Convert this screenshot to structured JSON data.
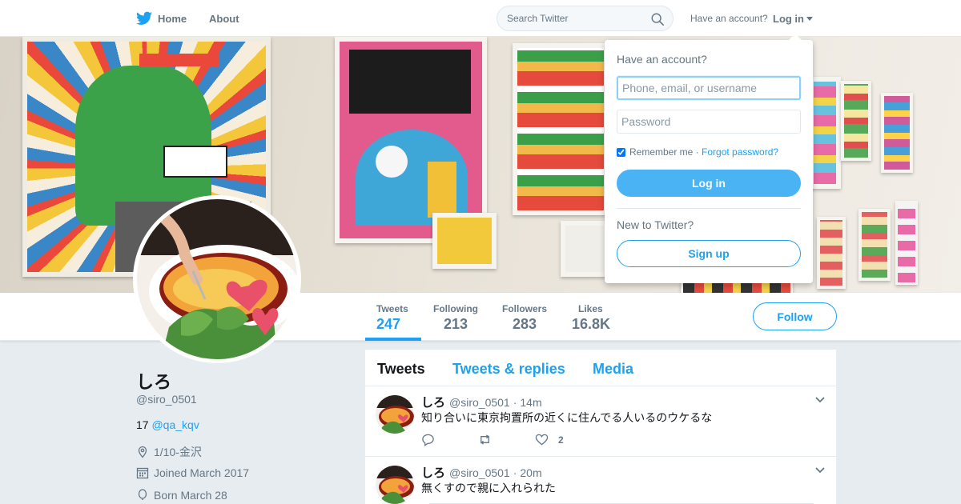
{
  "nav": {
    "home": "Home",
    "about": "About",
    "search_placeholder": "Search Twitter",
    "have_account": "Have an account?",
    "login": "Log in"
  },
  "profile": {
    "name": "しろ",
    "handle": "@siro_0501",
    "bio_prefix": "17",
    "bio_mention": "@qa_kqv",
    "location": "1/10-金沢",
    "joined": "Joined March 2017",
    "born": "Born March 28"
  },
  "stats": [
    {
      "label": "Tweets",
      "value": "247"
    },
    {
      "label": "Following",
      "value": "213"
    },
    {
      "label": "Followers",
      "value": "283"
    },
    {
      "label": "Likes",
      "value": "16.8K"
    }
  ],
  "follow_label": "Follow",
  "tabs": [
    "Tweets",
    "Tweets & replies",
    "Media"
  ],
  "tweets": [
    {
      "name": "しろ",
      "handle": "@siro_0501",
      "time": "14m",
      "text": "知り合いに東京拘置所の近くに住んでる人いるのウケるな",
      "likes": "2"
    },
    {
      "name": "しろ",
      "handle": "@siro_0501",
      "time": "20m",
      "text": "無くすので親に入れられた",
      "likes": ""
    }
  ],
  "login_dropdown": {
    "question": "Have an account?",
    "username_placeholder": "Phone, email, or username",
    "password_placeholder": "Password",
    "remember": "Remember me",
    "forgot": "Forgot password?",
    "login_button": "Log in",
    "new_question": "New to Twitter?",
    "signup_button": "Sign up"
  },
  "colors": {
    "accent": "#1da1f2",
    "login_button": "#4ab3f4",
    "page_bg": "#e6ecf0",
    "muted": "#657786"
  }
}
